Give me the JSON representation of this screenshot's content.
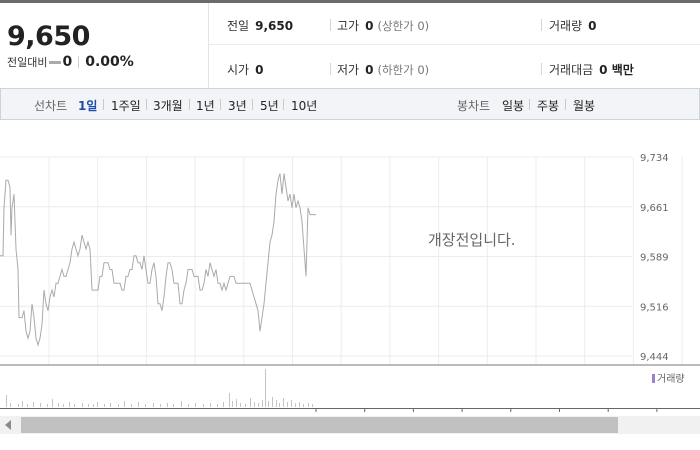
{
  "summary": {
    "price": "9,650",
    "diff_label": "전일대비",
    "diff_value": "0",
    "diff_pct": "0.00%",
    "prev_close": {
      "label": "전일",
      "value": "9,650"
    },
    "high": {
      "label": "고가",
      "value": "0",
      "sub": "(상한가 0)"
    },
    "volume": {
      "label": "거래량",
      "value": "0"
    },
    "open": {
      "label": "시가",
      "value": "0"
    },
    "low": {
      "label": "저가",
      "value": "0",
      "sub": "(하한가 0)"
    },
    "amount": {
      "label": "거래대금",
      "value": "0 백만"
    }
  },
  "tabs": {
    "line_label": "선차트",
    "line": [
      "1일",
      "1주일",
      "3개월",
      "1년",
      "3년",
      "5년",
      "10년"
    ],
    "active": "1일",
    "candle_label": "봉차트",
    "candle": [
      "일봉",
      "주봉",
      "월봉"
    ]
  },
  "chart_message": "개장전입니다.",
  "chart_data": {
    "type": "line",
    "ylim": [
      9444,
      9734
    ],
    "y_ticks": [
      "9,734",
      "9,661",
      "9,589",
      "9,516",
      "9,444"
    ],
    "price_path": [
      [
        0,
        9590
      ],
      [
        3,
        9590
      ],
      [
        4,
        9660
      ],
      [
        6,
        9700
      ],
      [
        8,
        9700
      ],
      [
        10,
        9690
      ],
      [
        11,
        9620
      ],
      [
        12,
        9660
      ],
      [
        14,
        9680
      ],
      [
        15,
        9640
      ],
      [
        16,
        9600
      ],
      [
        18,
        9570
      ],
      [
        19,
        9500
      ],
      [
        22,
        9500
      ],
      [
        24,
        9510
      ],
      [
        26,
        9480
      ],
      [
        28,
        9470
      ],
      [
        30,
        9480
      ],
      [
        32,
        9520
      ],
      [
        34,
        9500
      ],
      [
        36,
        9470
      ],
      [
        38,
        9460
      ],
      [
        40,
        9470
      ],
      [
        42,
        9490
      ],
      [
        44,
        9540
      ],
      [
        46,
        9520
      ],
      [
        48,
        9510
      ],
      [
        50,
        9530
      ],
      [
        52,
        9540
      ],
      [
        54,
        9530
      ],
      [
        56,
        9550
      ],
      [
        58,
        9550
      ],
      [
        60,
        9560
      ],
      [
        62,
        9570
      ],
      [
        64,
        9560
      ],
      [
        66,
        9560
      ],
      [
        68,
        9570
      ],
      [
        70,
        9580
      ],
      [
        72,
        9600
      ],
      [
        74,
        9610
      ],
      [
        76,
        9600
      ],
      [
        78,
        9590
      ],
      [
        80,
        9600
      ],
      [
        82,
        9620
      ],
      [
        84,
        9610
      ],
      [
        86,
        9600
      ],
      [
        88,
        9610
      ],
      [
        90,
        9600
      ],
      [
        92,
        9540
      ],
      [
        94,
        9540
      ],
      [
        96,
        9540
      ],
      [
        98,
        9540
      ],
      [
        100,
        9560
      ],
      [
        102,
        9560
      ],
      [
        104,
        9580
      ],
      [
        106,
        9580
      ],
      [
        108,
        9580
      ],
      [
        110,
        9570
      ],
      [
        112,
        9570
      ],
      [
        114,
        9550
      ],
      [
        116,
        9550
      ],
      [
        118,
        9550
      ],
      [
        120,
        9550
      ],
      [
        122,
        9540
      ],
      [
        124,
        9540
      ],
      [
        126,
        9560
      ],
      [
        128,
        9560
      ],
      [
        130,
        9570
      ],
      [
        132,
        9570
      ],
      [
        134,
        9590
      ],
      [
        136,
        9590
      ],
      [
        138,
        9580
      ],
      [
        140,
        9580
      ],
      [
        142,
        9570
      ],
      [
        144,
        9590
      ],
      [
        146,
        9570
      ],
      [
        148,
        9550
      ],
      [
        150,
        9550
      ],
      [
        152,
        9570
      ],
      [
        154,
        9580
      ],
      [
        156,
        9560
      ],
      [
        158,
        9520
      ],
      [
        160,
        9520
      ],
      [
        162,
        9510
      ],
      [
        164,
        9530
      ],
      [
        166,
        9560
      ],
      [
        168,
        9580
      ],
      [
        170,
        9580
      ],
      [
        172,
        9570
      ],
      [
        174,
        9550
      ],
      [
        176,
        9550
      ],
      [
        178,
        9550
      ],
      [
        180,
        9520
      ],
      [
        182,
        9520
      ],
      [
        184,
        9540
      ],
      [
        186,
        9550
      ],
      [
        188,
        9570
      ],
      [
        190,
        9570
      ],
      [
        192,
        9570
      ],
      [
        194,
        9560
      ],
      [
        196,
        9560
      ],
      [
        198,
        9560
      ],
      [
        200,
        9540
      ],
      [
        202,
        9540
      ],
      [
        204,
        9550
      ],
      [
        206,
        9570
      ],
      [
        208,
        9560
      ],
      [
        210,
        9580
      ],
      [
        212,
        9570
      ],
      [
        214,
        9560
      ],
      [
        216,
        9570
      ],
      [
        218,
        9550
      ],
      [
        220,
        9550
      ],
      [
        222,
        9540
      ],
      [
        224,
        9550
      ],
      [
        226,
        9540
      ],
      [
        228,
        9550
      ],
      [
        230,
        9560
      ],
      [
        232,
        9560
      ],
      [
        234,
        9560
      ],
      [
        236,
        9550
      ],
      [
        238,
        9550
      ],
      [
        240,
        9550
      ],
      [
        242,
        9550
      ],
      [
        244,
        9550
      ],
      [
        246,
        9550
      ],
      [
        248,
        9550
      ],
      [
        250,
        9550
      ],
      [
        252,
        9540
      ],
      [
        254,
        9530
      ],
      [
        256,
        9520
      ],
      [
        258,
        9510
      ],
      [
        260,
        9480
      ],
      [
        262,
        9500
      ],
      [
        264,
        9520
      ],
      [
        266,
        9550
      ],
      [
        268,
        9580
      ],
      [
        270,
        9610
      ],
      [
        272,
        9620
      ],
      [
        274,
        9640
      ],
      [
        276,
        9680
      ],
      [
        278,
        9700
      ],
      [
        280,
        9710
      ],
      [
        282,
        9680
      ],
      [
        284,
        9710
      ],
      [
        286,
        9690
      ],
      [
        288,
        9670
      ],
      [
        290,
        9680
      ],
      [
        292,
        9660
      ],
      [
        294,
        9680
      ],
      [
        296,
        9660
      ],
      [
        298,
        9670
      ],
      [
        300,
        9660
      ],
      [
        302,
        9640
      ],
      [
        304,
        9600
      ],
      [
        306,
        9560
      ],
      [
        308,
        9660
      ],
      [
        310,
        9650
      ],
      [
        312,
        9650
      ],
      [
        314,
        9650
      ],
      [
        316,
        9650
      ]
    ],
    "volume": [
      [
        6,
        12
      ],
      [
        10,
        4
      ],
      [
        18,
        3
      ],
      [
        22,
        6
      ],
      [
        27,
        3
      ],
      [
        33,
        5
      ],
      [
        40,
        4
      ],
      [
        47,
        3
      ],
      [
        52,
        8
      ],
      [
        58,
        4
      ],
      [
        63,
        3
      ],
      [
        69,
        5
      ],
      [
        74,
        3
      ],
      [
        82,
        4
      ],
      [
        88,
        3
      ],
      [
        93,
        3
      ],
      [
        97,
        5
      ],
      [
        104,
        3
      ],
      [
        110,
        4
      ],
      [
        118,
        3
      ],
      [
        124,
        6
      ],
      [
        131,
        3
      ],
      [
        138,
        5
      ],
      [
        145,
        3
      ],
      [
        153,
        4
      ],
      [
        160,
        3
      ],
      [
        167,
        4
      ],
      [
        173,
        3
      ],
      [
        181,
        6
      ],
      [
        188,
        3
      ],
      [
        195,
        4
      ],
      [
        203,
        3
      ],
      [
        210,
        4
      ],
      [
        217,
        3
      ],
      [
        223,
        5
      ],
      [
        229,
        14
      ],
      [
        232,
        6
      ],
      [
        236,
        8
      ],
      [
        240,
        4
      ],
      [
        245,
        3
      ],
      [
        250,
        9
      ],
      [
        254,
        5
      ],
      [
        258,
        4
      ],
      [
        262,
        7
      ],
      [
        265,
        38
      ],
      [
        268,
        6
      ],
      [
        272,
        10
      ],
      [
        276,
        7
      ],
      [
        279,
        4
      ],
      [
        283,
        9
      ],
      [
        287,
        5
      ],
      [
        291,
        7
      ],
      [
        295,
        4
      ],
      [
        299,
        5
      ],
      [
        303,
        3
      ],
      [
        308,
        4
      ],
      [
        312,
        3
      ]
    ]
  },
  "volume_legend": "거래량"
}
